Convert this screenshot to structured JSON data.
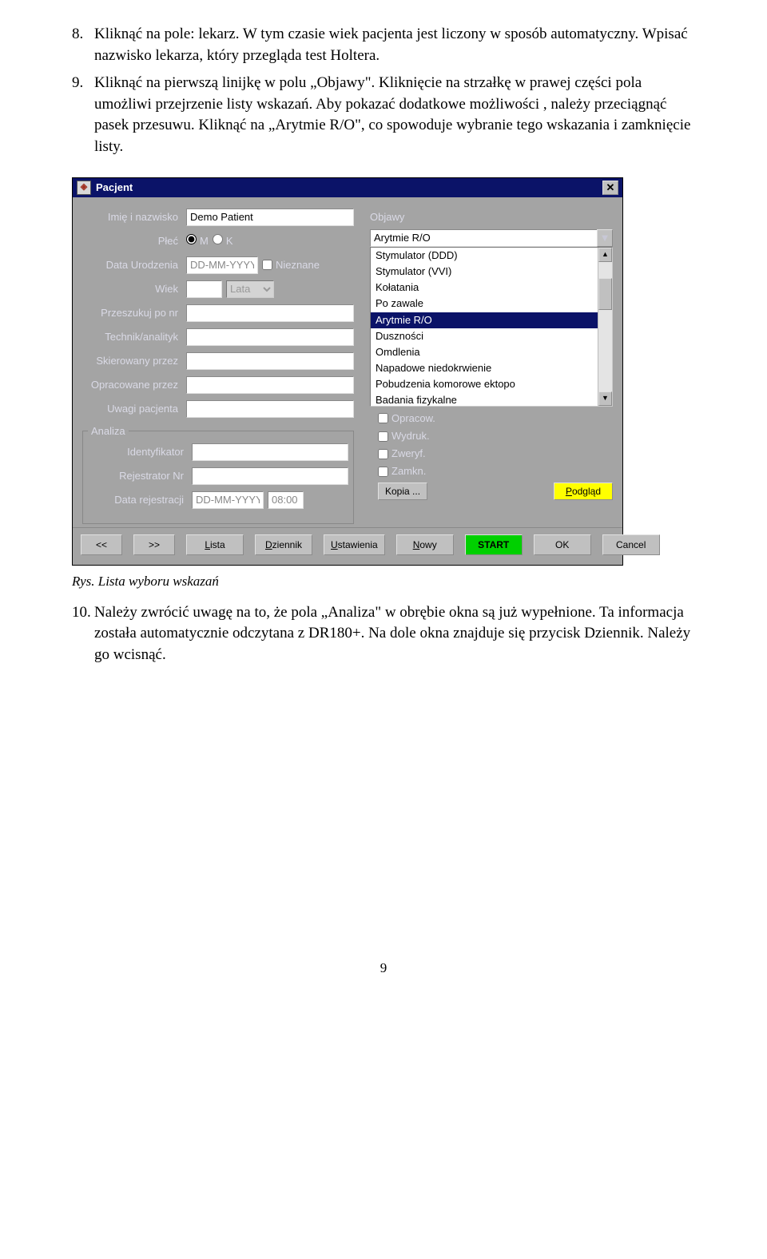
{
  "step8": {
    "num": "8.",
    "text": "Kliknąć na pole: lekarz. W tym czasie wiek pacjenta jest liczony w sposób automatyczny. Wpisać nazwisko lekarza, który przegląda test Holtera."
  },
  "step9": {
    "num": "9.",
    "text": "Kliknąć na pierwszą linijkę w polu „Objawy\". Kliknięcie na strzałkę w prawej części pola umożliwi przejrzenie listy wskazań. Aby pokazać dodatkowe możliwości , należy przeciągnąć pasek przesuwu. Kliknąć na „Arytmie R/O\", co spowoduje wybranie tego wskazania i zamknięcie listy."
  },
  "caption": "Rys. Lista wyboru wskazań",
  "step10": {
    "num": "10.",
    "text": "Należy zwrócić uwagę na to, że pola „Analiza\" w obrębie okna są już wypełnione. Ta informacja została automatycznie odczytana z DR180+. Na dole okna znajduje się przycisk Dziennik. Należy go wcisnąć."
  },
  "pageNum": "9",
  "dlg": {
    "title": "Pacjent",
    "left": {
      "name_lbl": "Imię i nazwisko",
      "name_val": "Demo Patient",
      "sex_lbl": "Płeć",
      "sex_m": "M",
      "sex_k": "K",
      "dob_lbl": "Data Urodzenia",
      "dob_val": "DD-MM-YYYY",
      "unknown": "Nieznane",
      "age_lbl": "Wiek",
      "age_unit": "Lata",
      "search_lbl": "Przeszukuj po nr",
      "tech_lbl": "Technik/analityk",
      "refby_lbl": "Skierowany przez",
      "procby_lbl": "Opracowane przez",
      "notes_lbl": "Uwagi pacjenta",
      "analiza_legend": "Analiza",
      "id_lbl": "Identyfikator",
      "rec_lbl": "Rejestrator Nr",
      "regdate_lbl": "Data rejestracji",
      "regdate_val": "DD-MM-YYYY",
      "regtime_val": "08:00"
    },
    "right": {
      "objawy_lbl": "Objawy",
      "combo_val": "Arytmie R/O",
      "items": [
        "Stymulator (DDD)",
        "Stymulator (VVI)",
        "Kołatania",
        "Po zawale",
        "Arytmie R/O",
        "Duszności",
        "Omdlenia",
        "Napadowe niedokrwienie",
        "Pobudzenia komorowe ektopo",
        "Badania fizykalne"
      ],
      "selected": "Arytmie R/O",
      "chk_opracow": "Opracow.",
      "chk_wydruk": "Wydruk.",
      "chk_zweryf": "Zweryf.",
      "chk_zamkn": "Zamkn.",
      "kopia": "Kopia ...",
      "podglad": "Podgląd"
    },
    "buttons": {
      "prev": "<<",
      "next": ">>",
      "lista": "Lista",
      "dziennik": "Dziennik",
      "ustawienia": "Ustawienia",
      "nowy": "Nowy",
      "start": "START",
      "ok": "OK",
      "cancel": "Cancel"
    }
  }
}
